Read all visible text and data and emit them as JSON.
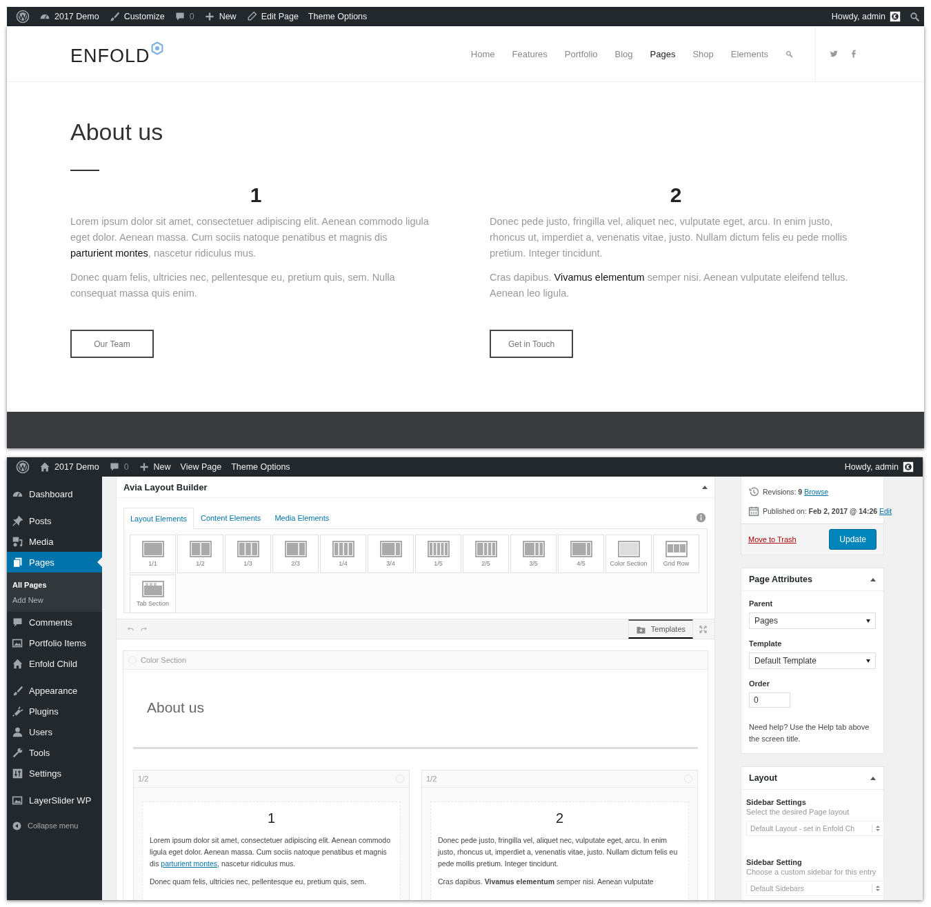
{
  "front_end": {
    "admin_bar": {
      "items": [
        {
          "kind": "wordpress"
        },
        {
          "kind": "gauge",
          "label": "2017 Demo"
        },
        {
          "kind": "brush",
          "label": "Customize"
        },
        {
          "kind": "comment",
          "label": "0"
        },
        {
          "kind": "plus",
          "label": "New"
        },
        {
          "kind": "pencil",
          "label": "Edit Page"
        },
        {
          "kind": "plain",
          "label": "Theme Options"
        }
      ],
      "account": "Howdy, admin"
    },
    "header": {
      "logo": "ENFOLD",
      "nav": [
        {
          "label": "Home",
          "selected": false
        },
        {
          "label": "Features",
          "selected": false
        },
        {
          "label": "Portfolio",
          "selected": false
        },
        {
          "label": "Blog",
          "selected": false
        },
        {
          "label": "Pages",
          "selected": true
        },
        {
          "label": "Shop",
          "selected": false
        },
        {
          "label": "Elements",
          "selected": false
        }
      ]
    },
    "content": {
      "title": "About us",
      "columns": [
        {
          "heading": "1",
          "paragraphs": [
            {
              "text": "Lorem ipsum dolor sit amet, consectetuer adipiscing elit. Aenean commodo ligula eget dolor. Aenean massa. Cum sociis natoque penatibus et magnis dis ",
              "link": "parturient montes",
              "after": ", nascetur ridiculus mus."
            },
            {
              "text": "Donec quam felis, ultricies nec, pellentesque eu, pretium quis, sem. Nulla consequat massa quis enim."
            }
          ],
          "button": "Our Team"
        },
        {
          "heading": "2",
          "paragraphs": [
            {
              "text": "Donec pede justo, fringilla vel, aliquet nec, vulputate eget, arcu. In enim justo, rhoncus ut, imperdiet a, venenatis vitae, justo. Nullam dictum felis eu pede mollis pretium. Integer tincidunt."
            },
            {
              "text": "Cras dapibus. **Vivamus elementum** semper nisi. Aenean vulputate eleifend tellus. Aenean leo ligula."
            }
          ],
          "button": "Get in Touch"
        }
      ]
    }
  },
  "admin": {
    "admin_bar": {
      "items": [
        {
          "kind": "wordpress"
        },
        {
          "kind": "home",
          "label": "2017 Demo"
        },
        {
          "kind": "comment",
          "label": "0"
        },
        {
          "kind": "plus",
          "label": "New"
        },
        {
          "kind": "plain",
          "label": "View Page"
        },
        {
          "kind": "plain",
          "label": "Theme Options"
        }
      ],
      "account": "Howdy, admin"
    },
    "menu": {
      "groups": [
        [
          {
            "kind": "gauge",
            "label": "Dashboard",
            "selected": false
          }
        ],
        [
          {
            "kind": "pin",
            "label": "Posts",
            "selected": false
          },
          {
            "kind": "media",
            "label": "Media",
            "selected": false
          },
          {
            "kind": "pages",
            "label": "Pages",
            "selected": true,
            "children": [
              {
                "label": "All Pages",
                "selected": true
              },
              {
                "label": "Add New",
                "selected": false
              }
            ]
          },
          {
            "kind": "comment",
            "label": "Comments",
            "selected": false
          },
          {
            "kind": "picture",
            "label": "Portfolio Items",
            "selected": false
          },
          {
            "kind": "home",
            "label": "Enfold Child",
            "selected": false
          }
        ],
        [
          {
            "kind": "brush",
            "label": "Appearance",
            "selected": false
          },
          {
            "kind": "plug",
            "label": "Plugins",
            "selected": false
          },
          {
            "kind": "user",
            "label": "Users",
            "selected": false
          },
          {
            "kind": "wrench",
            "label": "Tools",
            "selected": false
          },
          {
            "kind": "sliders",
            "label": "Settings",
            "selected": false
          }
        ],
        [
          {
            "kind": "picture",
            "label": "LayerSlider WP",
            "selected": false
          }
        ]
      ],
      "collapse": "Collapse menu"
    },
    "builder": {
      "title": "Avia Layout Builder",
      "tabs": [
        {
          "label": "Layout Elements",
          "selected": true
        },
        {
          "label": "Content Elements",
          "selected": false
        },
        {
          "label": "Media Elements",
          "selected": false
        }
      ],
      "elements": [
        {
          "kind": "columns",
          "label": "1/1"
        },
        {
          "kind": "columns",
          "label": "1/2"
        },
        {
          "kind": "columns",
          "label": "1/3"
        },
        {
          "kind": "columns",
          "label": "2/3"
        },
        {
          "kind": "columns",
          "label": "1/4"
        },
        {
          "kind": "columns",
          "label": "3/4"
        },
        {
          "kind": "columns",
          "label": "1/5"
        },
        {
          "kind": "columns",
          "label": "2/5"
        },
        {
          "kind": "columns",
          "label": "3/5"
        },
        {
          "kind": "columns",
          "label": "4/5"
        },
        {
          "kind": "color-section",
          "label": "Color Section"
        },
        {
          "kind": "grid-row",
          "label": "Grid Row"
        },
        {
          "kind": "tab-section",
          "label": "Tab Section"
        }
      ],
      "templates_button": "Templates",
      "canvas": {
        "section_label": "Color Section",
        "title": "About us",
        "columns": [
          {
            "label": "1/2",
            "heading": "1",
            "paragraphs": [
              {
                "text": "Lorem ipsum dolor sit amet, consectetuer adipiscing elit. Aenean commodo ligula eget dolor. Aenean massa. Cum sociis natoque penatibus et magnis dis ",
                "link": "parturient montes",
                "after": ", nascetur ridiculus mus."
              },
              {
                "text": "Donec quam felis, ultricies nec, pellentesque eu, pretium quis, sem."
              }
            ]
          },
          {
            "label": "1/2",
            "heading": "2",
            "paragraphs": [
              {
                "text": "Donec pede justo, fringilla vel, aliquet nec, vulputate eget, arcu. In enim justo, rhoncus ut, imperdiet a, venenatis vitae, justo. Nullam dictum felis eu pede mollis pretium. Integer tincidunt."
              },
              {
                "text": "Cras dapibus. **Vivamus elementum** semper nisi. Aenean vulputate"
              }
            ]
          }
        ]
      }
    },
    "publish": {
      "revisions": "Revisions: **9**",
      "revisions_link": "Browse",
      "published": "Published on: **Feb 2, 2017 @ 14:26**",
      "published_link": "Edit",
      "trash": "Move to Trash",
      "update": "Update"
    },
    "page_attributes": {
      "title": "Page Attributes",
      "parent_label": "Parent",
      "parent_value": "Pages",
      "template_label": "Template",
      "template_value": "Default Template",
      "order_label": "Order",
      "order_value": "0",
      "help": "Need help? Use the Help tab above the screen title."
    },
    "layout_box": {
      "title": "Layout",
      "settings": [
        {
          "label": "Sidebar Settings",
          "description": "Select the desired Page layout",
          "value": "Default Layout - set in Enfold Ch"
        },
        {
          "label": "Sidebar Setting",
          "description": "Choose a custom sidebar for this entry",
          "value": "Default Sidebars"
        }
      ]
    }
  }
}
